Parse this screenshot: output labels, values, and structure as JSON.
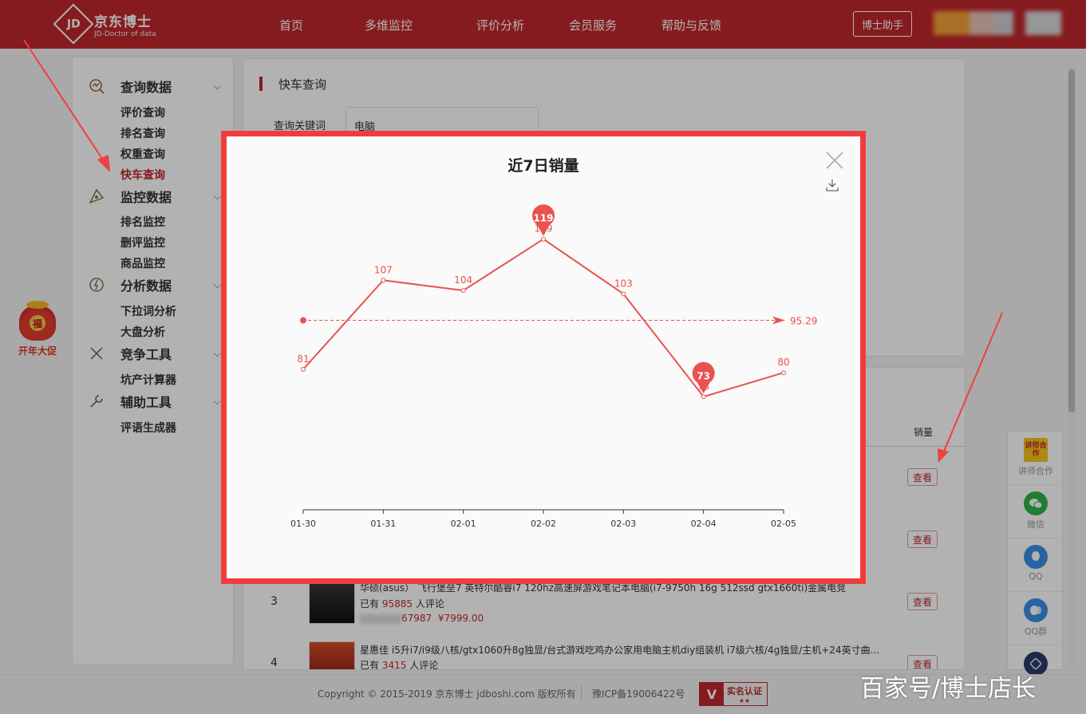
{
  "header": {
    "logo_cn": "京东博士",
    "logo_en": "JD-Doctor of data",
    "nav": [
      "首页",
      "多维监控",
      "评价分析",
      "会员服务",
      "帮助与反馈"
    ],
    "helper_button": "博士助手"
  },
  "sidebar": {
    "groups": [
      {
        "title": "查询数据",
        "icon": "analytics-icon",
        "items": [
          "评价查询",
          "排名查询",
          "权重查询",
          "快车查询"
        ]
      },
      {
        "title": "监控数据",
        "icon": "monitor-icon",
        "items": [
          "排名监控",
          "删评监控",
          "商品监控"
        ]
      },
      {
        "title": "分析数据",
        "icon": "chart-icon",
        "items": [
          "下拉词分析",
          "大盘分析"
        ]
      },
      {
        "title": "竞争工具",
        "icon": "swords-icon",
        "items": [
          "坑产计算器"
        ]
      },
      {
        "title": "辅助工具",
        "icon": "wrench-icon",
        "items": [
          "评语生成器"
        ]
      }
    ],
    "active_item": "快车查询"
  },
  "promo_badge": {
    "char": "福",
    "label": "开年大促"
  },
  "query_panel": {
    "title": "快车查询",
    "keyword_label": "查询关键词",
    "keyword_value": "电脑"
  },
  "results": {
    "sales_header": "销量",
    "view_label": "查看",
    "rows": [
      {
        "rank": "3",
        "title": "华硕(asus） 飞行堡垒7 英特尔酷睿i7 120hz高速屏游戏笔记本电脑(i7-9750h 16g 512ssd gtx1660ti)金属电竞",
        "comments_prefix": "已有",
        "comments": "95885",
        "comments_suffix": "人评论",
        "price_tail": "67987",
        "price": "¥7999.00"
      },
      {
        "rank": "4",
        "title": "星惠佳 i5升i7/i9级八核/gtx1060升8g独显/台式游戏吃鸡办公家用电脑主机diy组装机 i7级六核/4g独显/主机+24英寸曲...",
        "comments_prefix": "已有",
        "comments": "3415",
        "comments_suffix": "人评论"
      }
    ]
  },
  "modal": {
    "title": "近7日销量"
  },
  "chart_data": {
    "type": "line",
    "title": "近7日销量",
    "categories": [
      "01-30",
      "01-31",
      "02-01",
      "02-02",
      "02-03",
      "02-04",
      "02-05"
    ],
    "values": [
      81,
      107,
      104,
      119,
      103,
      73,
      80
    ],
    "max_marker": {
      "x": "02-02",
      "value": 119
    },
    "min_marker": {
      "x": "02-04",
      "value": 73
    },
    "average_line": {
      "value": 95.29,
      "label": "95.29"
    },
    "color": "#e8534f",
    "grid": false
  },
  "right_float": {
    "items": [
      {
        "label": "讲师合作",
        "icon": "lecturer-icon",
        "badge": "讲师合作"
      },
      {
        "label": "微信",
        "icon": "wechat-icon"
      },
      {
        "label": "QQ",
        "icon": "qq-icon"
      },
      {
        "label": "QQ群",
        "icon": "qq-group-icon"
      }
    ]
  },
  "footer": {
    "copyright": "Copyright © 2015-2019 京东博士 jdboshi.com 版权所有",
    "icp": "豫ICP备19006422号",
    "cert_label": "实名认证",
    "cert_stars": "★★"
  },
  "watermark": "百家号/博士店长",
  "colors": {
    "brand": "#c1272d",
    "series": "#e8534f",
    "modal_border": "#f23c3c"
  }
}
